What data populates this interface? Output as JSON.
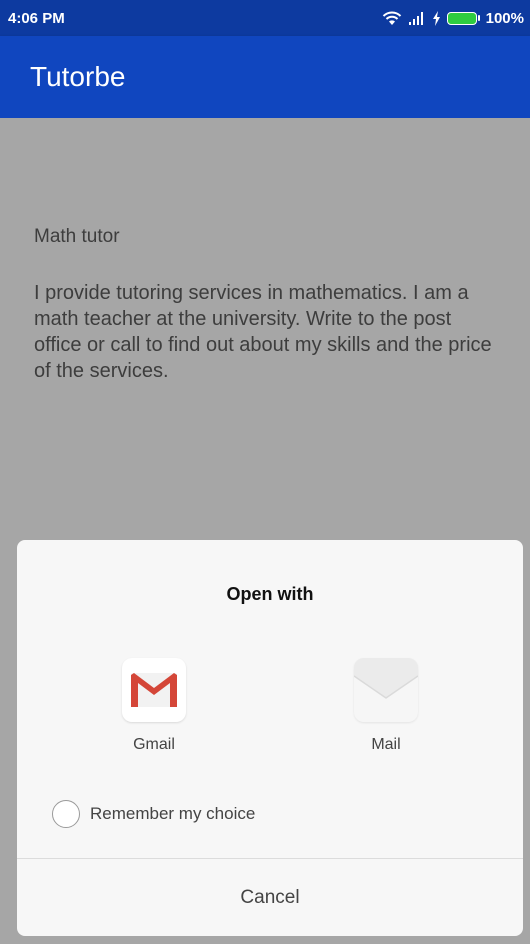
{
  "status_bar": {
    "time": "4:06 PM",
    "battery_percent": "100%",
    "icons": [
      "wifi-icon",
      "signal-icon",
      "charging-icon",
      "battery-icon"
    ]
  },
  "app_bar": {
    "title": "Tutorbe"
  },
  "listing": {
    "title": "Math tutor",
    "description": "I provide tutoring services in mathematics. I am a math teacher at the university. Write to the post office or call to find out about my skills and the price of the services."
  },
  "chooser": {
    "title": "Open with",
    "apps": [
      {
        "label": "Gmail",
        "icon": "gmail-icon"
      },
      {
        "label": "Mail",
        "icon": "mail-icon"
      }
    ],
    "remember_label": "Remember my choice",
    "remember_checked": false,
    "cancel_label": "Cancel"
  },
  "colors": {
    "status_bar": "#0d3aa0",
    "app_bar": "#1046bf",
    "scrim": "#a6a6a6",
    "sheet": "#f7f7f7",
    "gmail_red": "#d44638"
  }
}
